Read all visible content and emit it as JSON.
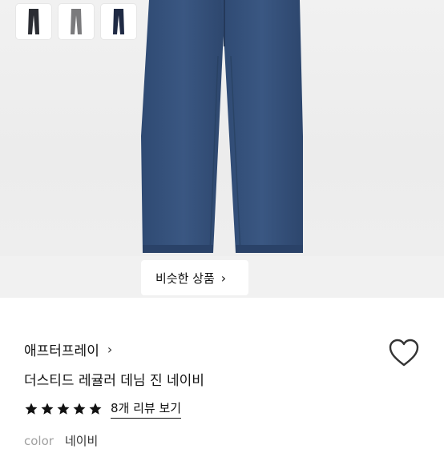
{
  "gallery": {
    "thumbnails": [
      {
        "color": "#2b2d33",
        "alt_icon": "pants-black-icon"
      },
      {
        "color": "#7a7a7c",
        "alt_icon": "pants-gray-icon"
      },
      {
        "color": "#1f2a44",
        "alt_icon": "pants-navy-icon"
      }
    ],
    "similar_label": "비슷한 상품",
    "similar_chevron": "›",
    "hero_color": "#34507a"
  },
  "product": {
    "brand": "애프터프레이",
    "brand_chevron": "›",
    "name": "더스티드 레귤러 데님 진 네이비",
    "rating_stars": 5,
    "reviews_label": "8개 리뷰 보기",
    "color_label": "color",
    "color_value": "네이비"
  }
}
